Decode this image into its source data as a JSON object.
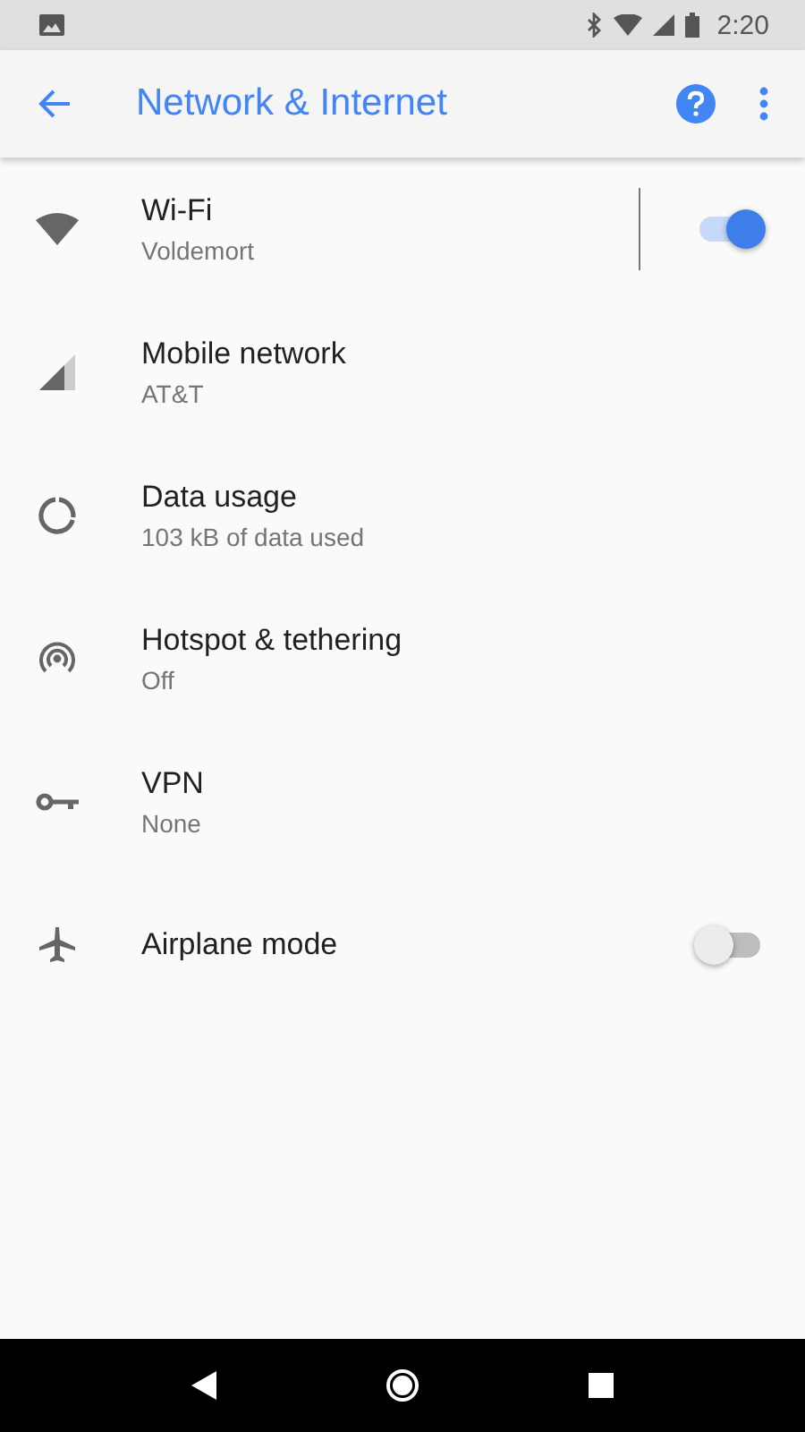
{
  "status_bar": {
    "time": "2:20"
  },
  "app_bar": {
    "title": "Network & Internet"
  },
  "items": [
    {
      "kind": "toggle",
      "title": "Wi-Fi",
      "subtitle": "Voldemort",
      "on": true
    },
    {
      "kind": "plain",
      "title": "Mobile network",
      "subtitle": "AT&T"
    },
    {
      "kind": "plain",
      "title": "Data usage",
      "subtitle": "103 kB of data used"
    },
    {
      "kind": "plain",
      "title": "Hotspot & tethering",
      "subtitle": "Off"
    },
    {
      "kind": "plain",
      "title": "VPN",
      "subtitle": "None"
    },
    {
      "kind": "toggle",
      "title": "Airplane mode",
      "on": false
    }
  ]
}
